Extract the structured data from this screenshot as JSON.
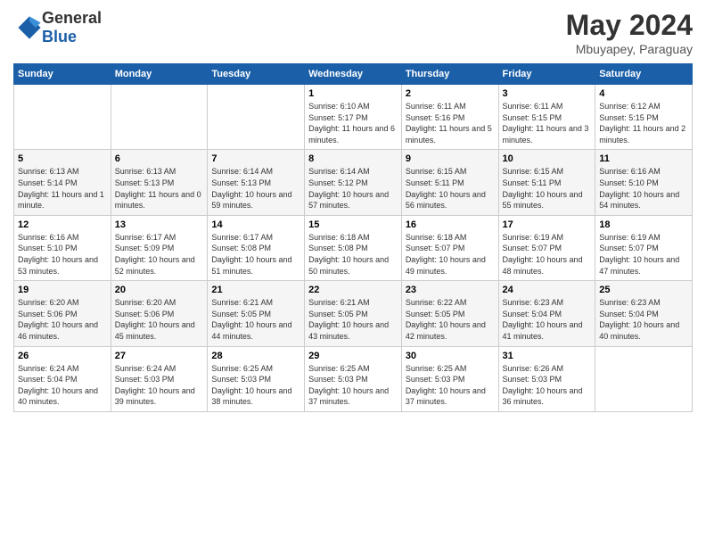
{
  "logo": {
    "general": "General",
    "blue": "Blue"
  },
  "header": {
    "month": "May 2024",
    "location": "Mbuyapey, Paraguay"
  },
  "weekdays": [
    "Sunday",
    "Monday",
    "Tuesday",
    "Wednesday",
    "Thursday",
    "Friday",
    "Saturday"
  ],
  "weeks": [
    [
      {
        "day": "",
        "info": ""
      },
      {
        "day": "",
        "info": ""
      },
      {
        "day": "",
        "info": ""
      },
      {
        "day": "1",
        "info": "Sunrise: 6:10 AM\nSunset: 5:17 PM\nDaylight: 11 hours and 6 minutes."
      },
      {
        "day": "2",
        "info": "Sunrise: 6:11 AM\nSunset: 5:16 PM\nDaylight: 11 hours and 5 minutes."
      },
      {
        "day": "3",
        "info": "Sunrise: 6:11 AM\nSunset: 5:15 PM\nDaylight: 11 hours and 3 minutes."
      },
      {
        "day": "4",
        "info": "Sunrise: 6:12 AM\nSunset: 5:15 PM\nDaylight: 11 hours and 2 minutes."
      }
    ],
    [
      {
        "day": "5",
        "info": "Sunrise: 6:13 AM\nSunset: 5:14 PM\nDaylight: 11 hours and 1 minute."
      },
      {
        "day": "6",
        "info": "Sunrise: 6:13 AM\nSunset: 5:13 PM\nDaylight: 11 hours and 0 minutes."
      },
      {
        "day": "7",
        "info": "Sunrise: 6:14 AM\nSunset: 5:13 PM\nDaylight: 10 hours and 59 minutes."
      },
      {
        "day": "8",
        "info": "Sunrise: 6:14 AM\nSunset: 5:12 PM\nDaylight: 10 hours and 57 minutes."
      },
      {
        "day": "9",
        "info": "Sunrise: 6:15 AM\nSunset: 5:11 PM\nDaylight: 10 hours and 56 minutes."
      },
      {
        "day": "10",
        "info": "Sunrise: 6:15 AM\nSunset: 5:11 PM\nDaylight: 10 hours and 55 minutes."
      },
      {
        "day": "11",
        "info": "Sunrise: 6:16 AM\nSunset: 5:10 PM\nDaylight: 10 hours and 54 minutes."
      }
    ],
    [
      {
        "day": "12",
        "info": "Sunrise: 6:16 AM\nSunset: 5:10 PM\nDaylight: 10 hours and 53 minutes."
      },
      {
        "day": "13",
        "info": "Sunrise: 6:17 AM\nSunset: 5:09 PM\nDaylight: 10 hours and 52 minutes."
      },
      {
        "day": "14",
        "info": "Sunrise: 6:17 AM\nSunset: 5:08 PM\nDaylight: 10 hours and 51 minutes."
      },
      {
        "day": "15",
        "info": "Sunrise: 6:18 AM\nSunset: 5:08 PM\nDaylight: 10 hours and 50 minutes."
      },
      {
        "day": "16",
        "info": "Sunrise: 6:18 AM\nSunset: 5:07 PM\nDaylight: 10 hours and 49 minutes."
      },
      {
        "day": "17",
        "info": "Sunrise: 6:19 AM\nSunset: 5:07 PM\nDaylight: 10 hours and 48 minutes."
      },
      {
        "day": "18",
        "info": "Sunrise: 6:19 AM\nSunset: 5:07 PM\nDaylight: 10 hours and 47 minutes."
      }
    ],
    [
      {
        "day": "19",
        "info": "Sunrise: 6:20 AM\nSunset: 5:06 PM\nDaylight: 10 hours and 46 minutes."
      },
      {
        "day": "20",
        "info": "Sunrise: 6:20 AM\nSunset: 5:06 PM\nDaylight: 10 hours and 45 minutes."
      },
      {
        "day": "21",
        "info": "Sunrise: 6:21 AM\nSunset: 5:05 PM\nDaylight: 10 hours and 44 minutes."
      },
      {
        "day": "22",
        "info": "Sunrise: 6:21 AM\nSunset: 5:05 PM\nDaylight: 10 hours and 43 minutes."
      },
      {
        "day": "23",
        "info": "Sunrise: 6:22 AM\nSunset: 5:05 PM\nDaylight: 10 hours and 42 minutes."
      },
      {
        "day": "24",
        "info": "Sunrise: 6:23 AM\nSunset: 5:04 PM\nDaylight: 10 hours and 41 minutes."
      },
      {
        "day": "25",
        "info": "Sunrise: 6:23 AM\nSunset: 5:04 PM\nDaylight: 10 hours and 40 minutes."
      }
    ],
    [
      {
        "day": "26",
        "info": "Sunrise: 6:24 AM\nSunset: 5:04 PM\nDaylight: 10 hours and 40 minutes."
      },
      {
        "day": "27",
        "info": "Sunrise: 6:24 AM\nSunset: 5:03 PM\nDaylight: 10 hours and 39 minutes."
      },
      {
        "day": "28",
        "info": "Sunrise: 6:25 AM\nSunset: 5:03 PM\nDaylight: 10 hours and 38 minutes."
      },
      {
        "day": "29",
        "info": "Sunrise: 6:25 AM\nSunset: 5:03 PM\nDaylight: 10 hours and 37 minutes."
      },
      {
        "day": "30",
        "info": "Sunrise: 6:25 AM\nSunset: 5:03 PM\nDaylight: 10 hours and 37 minutes."
      },
      {
        "day": "31",
        "info": "Sunrise: 6:26 AM\nSunset: 5:03 PM\nDaylight: 10 hours and 36 minutes."
      },
      {
        "day": "",
        "info": ""
      }
    ]
  ]
}
